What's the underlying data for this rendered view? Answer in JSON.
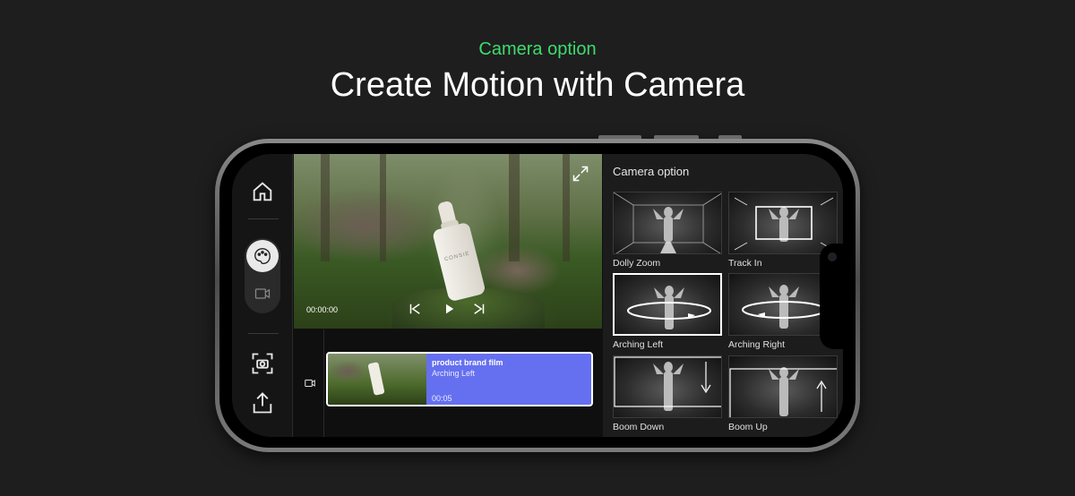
{
  "header": {
    "eyebrow": "Camera option",
    "title": "Create Motion with Camera"
  },
  "rail": {
    "icons": [
      "home-icon",
      "palette-icon",
      "video-icon",
      "screenshot-icon",
      "share-icon"
    ]
  },
  "preview": {
    "timecode": "00:00:00",
    "bottle_label": "CONSIE"
  },
  "timeline": {
    "clip": {
      "title": "product brand film",
      "subtitle": "Arching Left",
      "duration": "00:05"
    }
  },
  "camera_panel": {
    "title": "Camera option",
    "selected": "Arching Left",
    "options": [
      {
        "label": "Dolly Zoom"
      },
      {
        "label": "Track In"
      },
      {
        "label": "Arching Left"
      },
      {
        "label": "Arching Right"
      },
      {
        "label": "Boom Down"
      },
      {
        "label": "Boom Up"
      }
    ]
  },
  "colors": {
    "accent_green": "#3ddc6e",
    "clip_blue": "#6570f0",
    "background": "#1e1e1e"
  }
}
